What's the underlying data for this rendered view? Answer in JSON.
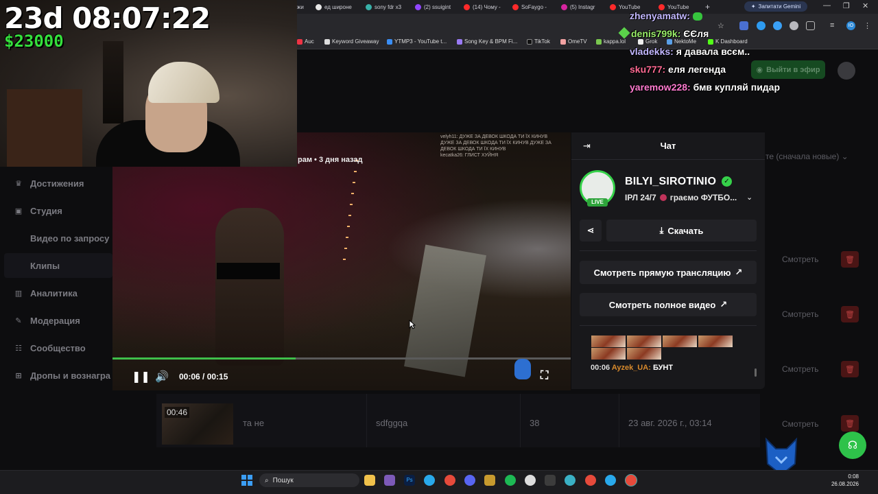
{
  "stream_overlay": {
    "timer": "23d 08:07:22",
    "money": "$23000"
  },
  "overlay_chat": [
    {
      "user": "zhenyamatw:",
      "message": ""
    },
    {
      "user": "denis799k:",
      "message": "ЄЄля"
    },
    {
      "user": "vladekks:",
      "message": "я давала всєм.."
    },
    {
      "user": "sku777:",
      "message": "еля легенда"
    },
    {
      "user": "yaremow228:",
      "message": "бмв купляй пидар"
    }
  ],
  "browser": {
    "tabs": [
      "жи",
      "ед широне",
      "sony fdr x3",
      "(2) ssuigint",
      "(14) Чому -",
      "SoFaygo -",
      "(5) Instagr",
      "YouTube",
      "YouTube"
    ],
    "gemini_label": "Запитати Gemini",
    "new_tab": "+",
    "window_controls": [
      "—",
      "❐",
      "✕"
    ],
    "profile_label": "IO",
    "bookmarks": [
      "Auc",
      "Keyword Giveaway",
      "YTMP3 - YouTube t...",
      "Song Key & BPM Fi...",
      "TikTok",
      "OmeTV",
      "kappa.lol",
      "Grok",
      "NektoMe",
      "K Dashboard"
    ]
  },
  "header": {
    "go_live_label": "Выйти в эфир"
  },
  "sidebar": {
    "items": [
      {
        "icon": "trophy-icon",
        "label": "Достижения"
      },
      {
        "icon": "studio-icon",
        "label": "Студия"
      },
      {
        "icon": "",
        "label": "Видео по запросу"
      },
      {
        "icon": "",
        "label": "Клипы"
      },
      {
        "icon": "chart-icon",
        "label": "Аналитика"
      },
      {
        "icon": "wrench-icon",
        "label": "Модерация"
      },
      {
        "icon": "community-icon",
        "label": "Сообщество"
      },
      {
        "icon": "gift-icon",
        "label": "Дропы и вознагра"
      }
    ]
  },
  "table": {
    "sort_label": "те (сначала новые)",
    "watch_label": "Смотреть",
    "visible_row": {
      "duration": "00:46",
      "title": "та не",
      "author": "sdfggqa",
      "views": "38",
      "date": "23 авг. 2026 г., 03:14"
    }
  },
  "player": {
    "caption": "рам • 3 дня назад",
    "burned_chat": [
      "velyh11: ДУЖЕ ЗА ДЕВОК ШКОДА ТИ ЇХ КИНУВ",
      "ДУЖЕ ЗА ДЕВОК ШКОДА ТИ ЇХ КИНУВ ДУЖЕ ЗА",
      "ДЕВОК ШКОДА ТИ ЇХ КИНУВ",
      "kecatka26: ГЛИСТ ХУЙНЯ"
    ],
    "time_display": "00:06 / 00:15",
    "progress": 0.4
  },
  "panel": {
    "title": "Чат",
    "channel_name": "BILYI_SIROTINIO",
    "live_label": "LIVE",
    "stream_title": "IРЛ 24/7",
    "category": "граємо ФУТБО...",
    "download_label": "Скачать",
    "watch_live_label": "Смотреть прямую трансляцию",
    "watch_full_label": "Смотреть полное видео",
    "chat_message": {
      "time": "00:06",
      "user": "Ayzek_UA",
      "text": "БУНТ"
    }
  },
  "taskbar": {
    "search_label": "Пошук",
    "time": "0:08",
    "date": "26.08.2026"
  },
  "colors": {
    "accent_green": "#36d14a",
    "progress_green": "#3fbf4a",
    "danger": "#b84040"
  }
}
